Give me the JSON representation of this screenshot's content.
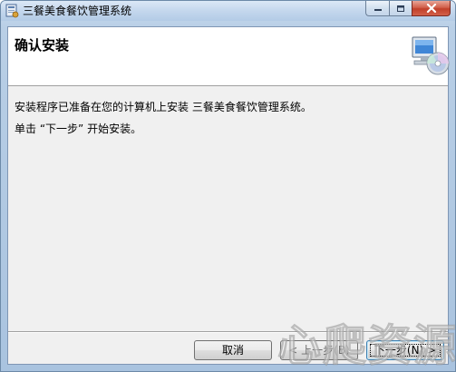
{
  "window": {
    "title": "三餐美食餐饮管理系统",
    "icon": "installer-icon"
  },
  "caption": {
    "minimize_icon": "minimize-icon",
    "maximize_icon": "maximize-icon",
    "close_icon": "close-icon"
  },
  "banner": {
    "title": "确认安装",
    "icon": "computer-cd-icon"
  },
  "body": {
    "line1": "安装程序已准备在您的计算机上安装 三餐美食餐饮管理系统。",
    "line2": "单击 “下一步” 开始安装。"
  },
  "buttons": {
    "cancel": "取消",
    "back": "< 上一步(B)",
    "next": "下一步(N) >"
  },
  "watermark": "心爬资源",
  "colors": {
    "close_button": "#c1402a",
    "client_bg": "#f0f0f0",
    "banner_bg": "#ffffff",
    "frame": "#b9cfe6"
  }
}
